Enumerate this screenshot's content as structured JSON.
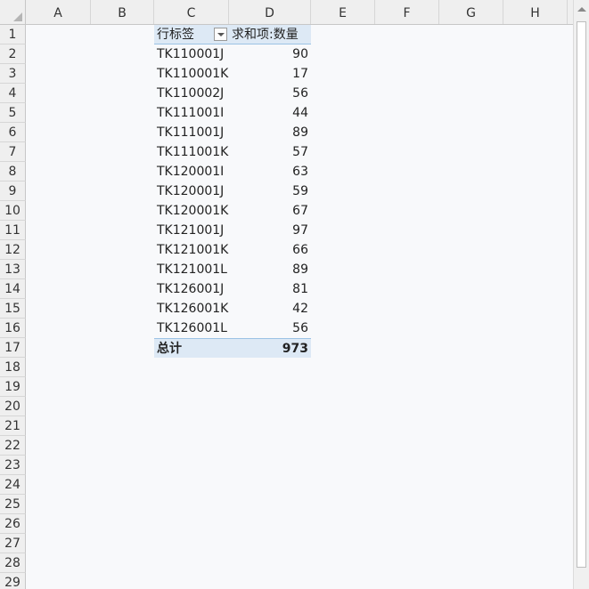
{
  "columns": [
    "A",
    "B",
    "C",
    "D",
    "E",
    "F",
    "G",
    "H"
  ],
  "rows": [
    "1",
    "2",
    "3",
    "4",
    "5",
    "6",
    "7",
    "8",
    "9",
    "10",
    "11",
    "12",
    "13",
    "14",
    "15",
    "16",
    "17",
    "18",
    "19",
    "20",
    "21",
    "22",
    "23",
    "24",
    "25",
    "26",
    "27",
    "28",
    "29"
  ],
  "pivot": {
    "row_label_header": "行标签",
    "value_header": "求和项:数量",
    "items": [
      {
        "label": "TK110001J",
        "value": "90"
      },
      {
        "label": "TK110001K",
        "value": "17"
      },
      {
        "label": "TK110002J",
        "value": "56"
      },
      {
        "label": "TK111001I",
        "value": "44"
      },
      {
        "label": "TK111001J",
        "value": "89"
      },
      {
        "label": "TK111001K",
        "value": "57"
      },
      {
        "label": "TK120001I",
        "value": "63"
      },
      {
        "label": "TK120001J",
        "value": "59"
      },
      {
        "label": "TK120001K",
        "value": "67"
      },
      {
        "label": "TK121001J",
        "value": "97"
      },
      {
        "label": "TK121001K",
        "value": "66"
      },
      {
        "label": "TK121001L",
        "value": "89"
      },
      {
        "label": "TK126001J",
        "value": "81"
      },
      {
        "label": "TK126001K",
        "value": "42"
      },
      {
        "label": "TK126001L",
        "value": "56"
      }
    ],
    "total_label": "总计",
    "total_value": "973"
  },
  "colors": {
    "pivot_header_bg": "#dde9f5",
    "pivot_border": "#9cc2e5",
    "header_bg": "#efefef"
  }
}
